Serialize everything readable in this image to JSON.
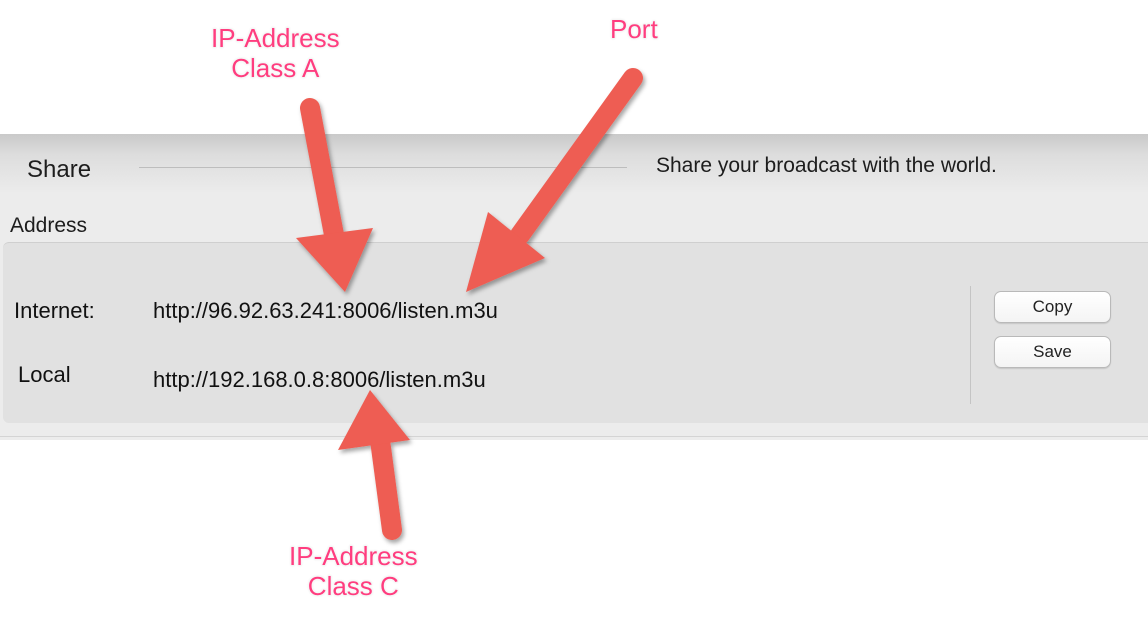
{
  "share": {
    "title": "Share",
    "subtitle": "Share your broadcast with the world."
  },
  "address": {
    "label": "Address",
    "rows": [
      {
        "label": "Internet:",
        "value": "http://96.92.63.241:8006/listen.m3u"
      },
      {
        "label": "Local",
        "value": "http://192.168.0.8:8006/listen.m3u"
      }
    ]
  },
  "buttons": {
    "copy": "Copy",
    "save": "Save"
  },
  "annotations": {
    "ip_class_a": [
      "IP-Address",
      "Class A"
    ],
    "port": "Port",
    "ip_class_c": [
      "IP-Address",
      "Class C"
    ],
    "color": "#ff3d7f",
    "arrow_color": "#ee5d52"
  }
}
